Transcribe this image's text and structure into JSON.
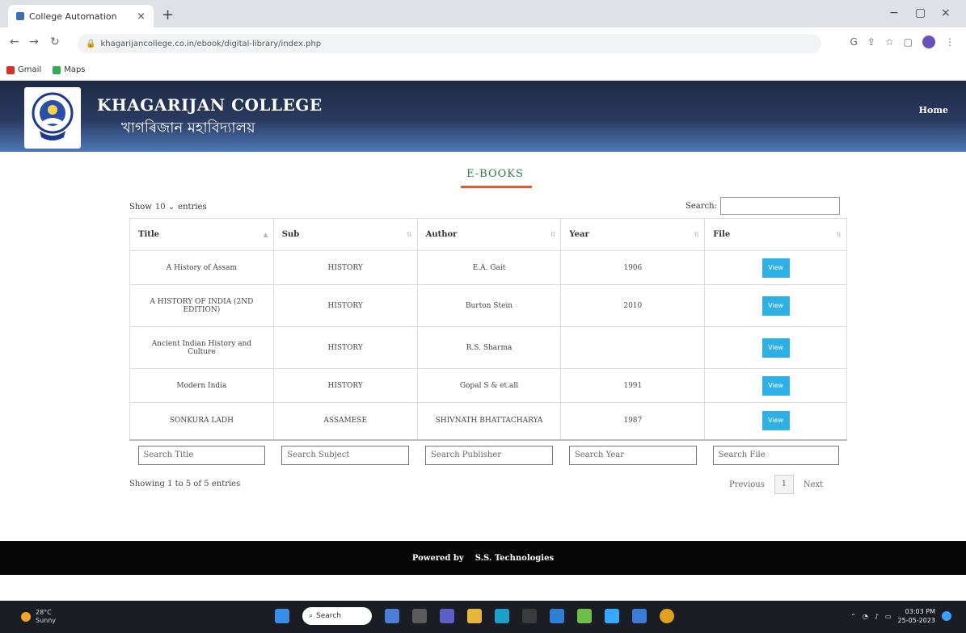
{
  "browser": {
    "tab_title": "College Automation",
    "tab_close": "×",
    "new_tab": "+",
    "url": "khagarijancollege.co.in/ebook/digital-library/index.php",
    "bookmarks": [
      "Gmail",
      "Maps"
    ],
    "minimize": "−",
    "restore": "▢",
    "close": "×"
  },
  "header": {
    "college_name_en": "KHAGARIJAN COLLEGE",
    "college_name_as": "খাগৰিজান মহাবিদ্যালয়",
    "nav_home": "Home"
  },
  "page": {
    "title": "E-BOOKS",
    "show_label": "Show",
    "show_value": "10",
    "entries_label": "entries",
    "search_label": "Search:"
  },
  "table": {
    "columns": [
      "Title",
      "Sub",
      "Author",
      "Year",
      "File"
    ],
    "rows": [
      {
        "title": "A History of Assam",
        "sub": "HISTORY",
        "author": "E.A. Gait",
        "year": "1906",
        "file": "View"
      },
      {
        "title": "A HISTORY OF INDIA (2ND EDITION)",
        "sub": "HISTORY",
        "author": "Burton Stein",
        "year": "2010",
        "file": "View"
      },
      {
        "title": "Ancient Indian History and Culture",
        "sub": "HISTORY",
        "author": "R.S. Sharma",
        "year": "",
        "file": "View"
      },
      {
        "title": "Modern India",
        "sub": "HISTORY",
        "author": "Gopal S & et.all",
        "year": "1991",
        "file": "View"
      },
      {
        "title": "SONKURA LADH",
        "sub": "ASSAMESE",
        "author": "SHIVNATH BHATTACHARYA",
        "year": "1987",
        "file": "View"
      }
    ],
    "filters": [
      "Search Title",
      "Search Subject",
      "Search Publisher",
      "Search Year",
      "Search File"
    ]
  },
  "pagination": {
    "info": "Showing 1 to 5 of 5 entries",
    "previous": "Previous",
    "page": "1",
    "next": "Next"
  },
  "footer": {
    "powered_by": "Powered by",
    "company": "S.S. Technologies"
  },
  "taskbar": {
    "weather_temp": "28°C",
    "weather_desc": "Sunny",
    "search_placeholder": "Search",
    "time": "03:03 PM",
    "date": "25-05-2023"
  }
}
